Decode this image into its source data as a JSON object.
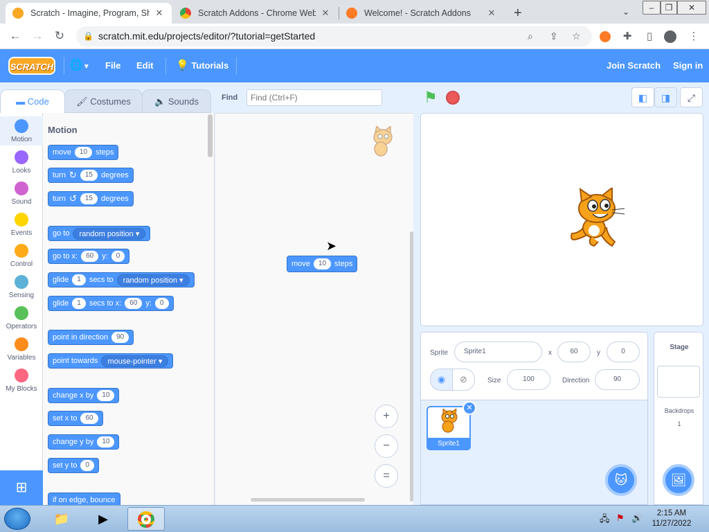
{
  "browser": {
    "tabs": [
      {
        "title": "Scratch - Imagine, Program, Share",
        "active": true
      },
      {
        "title": "Scratch Addons - Chrome Web Store",
        "active": false
      },
      {
        "title": "Welcome! - Scratch Addons",
        "active": false
      }
    ],
    "new_tab": "+",
    "url": "scratch.mit.edu/projects/editor/?tutorial=getStarted"
  },
  "menu": {
    "logo": "SCRATCH",
    "file": "File",
    "edit": "Edit",
    "tutorials": "Tutorials",
    "join": "Join Scratch",
    "signin": "Sign in"
  },
  "editor_tabs": {
    "code": "Code",
    "costumes": "Costumes",
    "sounds": "Sounds"
  },
  "find": {
    "label": "Find",
    "placeholder": "Find (Ctrl+F)"
  },
  "categories": [
    {
      "label": "Motion",
      "color": "#4c97ff"
    },
    {
      "label": "Looks",
      "color": "#9966ff"
    },
    {
      "label": "Sound",
      "color": "#cf63cf"
    },
    {
      "label": "Events",
      "color": "#ffd500"
    },
    {
      "label": "Control",
      "color": "#ffab19"
    },
    {
      "label": "Sensing",
      "color": "#5cb1d6"
    },
    {
      "label": "Operators",
      "color": "#59c059"
    },
    {
      "label": "Variables",
      "color": "#ff8c1a"
    },
    {
      "label": "My Blocks",
      "color": "#ff6680"
    }
  ],
  "palette": {
    "title": "Motion",
    "move": {
      "a": "move",
      "n": "10",
      "b": "steps"
    },
    "turn_right": {
      "a": "turn",
      "n": "15",
      "b": "degrees"
    },
    "turn_left": {
      "a": "turn",
      "n": "15",
      "b": "degrees"
    },
    "goto": {
      "a": "go to",
      "opt": "random position"
    },
    "gotoxy": {
      "a": "go to x:",
      "x": "60",
      "b": "y:",
      "y": "0"
    },
    "glide_to": {
      "a": "glide",
      "n": "1",
      "b": "secs to",
      "opt": "random position"
    },
    "glide_xy": {
      "a": "glide",
      "n": "1",
      "b": "secs to x:",
      "x": "60",
      "c": "y:",
      "y": "0"
    },
    "point_dir": {
      "a": "point in direction",
      "n": "90"
    },
    "point_towards": {
      "a": "point towards",
      "opt": "mouse-pointer"
    },
    "change_x": {
      "a": "change x by",
      "n": "10"
    },
    "set_x": {
      "a": "set x to",
      "n": "60"
    },
    "change_y": {
      "a": "change y by",
      "n": "10"
    },
    "set_y": {
      "a": "set y to",
      "n": "0"
    },
    "bounce": {
      "a": "if on edge, bounce"
    }
  },
  "workspace_block": {
    "a": "move",
    "n": "10",
    "b": "steps"
  },
  "zoom": {
    "in": "+",
    "out": "−",
    "reset": "="
  },
  "sprite_info": {
    "sprite_label": "Sprite",
    "sprite_name": "Sprite1",
    "x_label": "x",
    "x": "60",
    "y_label": "y",
    "y": "0",
    "size_label": "Size",
    "size": "100",
    "direction_label": "Direction",
    "direction": "90"
  },
  "sprites": [
    {
      "name": "Sprite1"
    }
  ],
  "stage_pane": {
    "title": "Stage",
    "backdrops_label": "Backdrops",
    "backdrops_count": "1"
  },
  "taskbar": {
    "time": "2:15 AM",
    "date": "11/27/2022"
  }
}
